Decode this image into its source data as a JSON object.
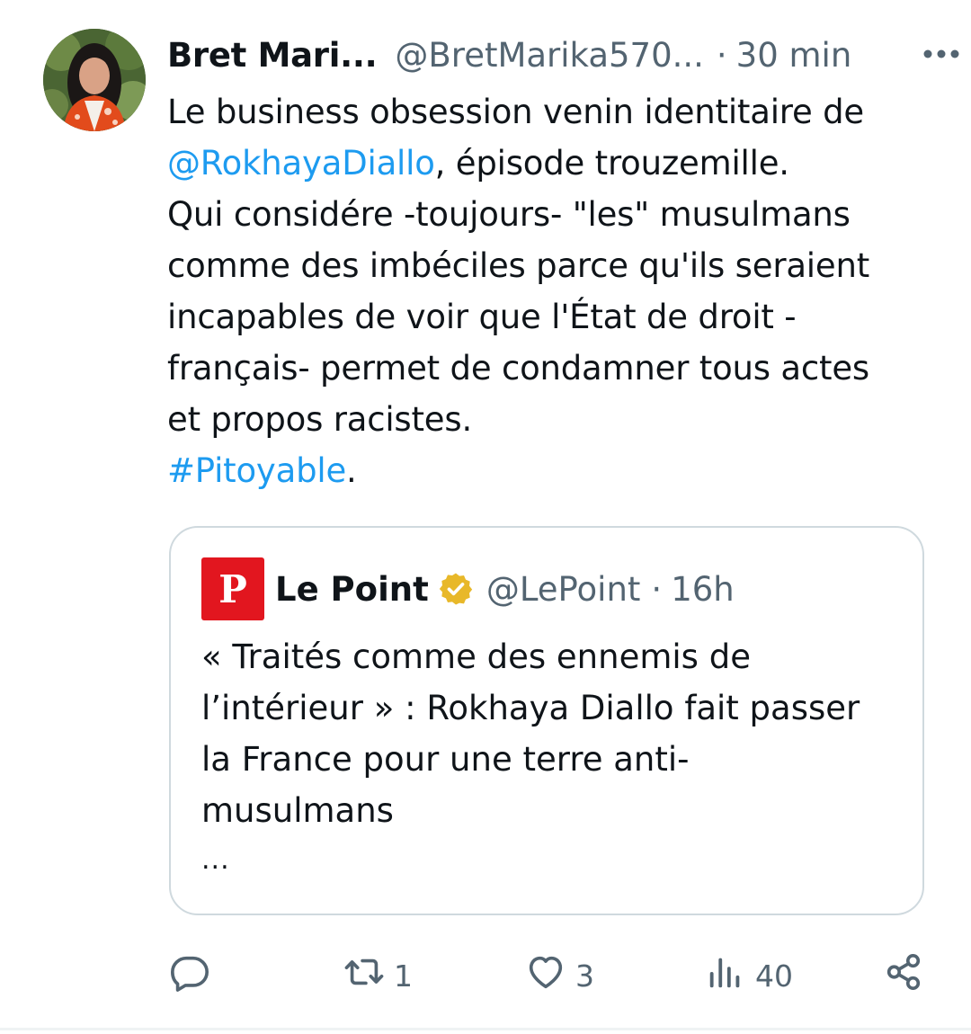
{
  "tweet": {
    "author_name": "Bret Mari...",
    "author_handle": "@BretMarika570...",
    "time_sep": "·",
    "timestamp": "30 min",
    "more_icon": "more-horizontal-icon",
    "text_lines": [
      "Le business obsession venin identitaire de",
      ", épisode trouzemille.",
      "Qui considére -toujours- \"les\" musulmans",
      "comme des imbéciles parce qu'ils seraient",
      "incapables de voir que l'État de droit -",
      "français- permet de condamner tous actes",
      "et propos racistes.",
      "."
    ],
    "mention": "@RokhayaDiallo",
    "hashtag": "#Pitoyable"
  },
  "quote": {
    "logo_letter": "P",
    "name": "Le Point",
    "badge_icon": "verified-gold-badge-icon",
    "handle": "@LePoint",
    "time_sep": "·",
    "timestamp": "16h",
    "text_lines": [
      "« Traités comme des ennemis de",
      "l’intérieur » : Rokhaya Diallo fait passer",
      "la France pour une terre anti-",
      "musulmans"
    ],
    "ellipsis": "..."
  },
  "actions": {
    "reply": {
      "icon": "reply-icon",
      "count": ""
    },
    "retweet": {
      "icon": "retweet-icon",
      "count": "1"
    },
    "like": {
      "icon": "heart-icon",
      "count": "3"
    },
    "views": {
      "icon": "views-icon",
      "count": "40"
    },
    "share": {
      "icon": "share-icon"
    }
  },
  "colors": {
    "link": "#1d9bf0",
    "secondary_text": "#536471",
    "primary_text": "#0f1419",
    "border": "#cfd9de",
    "le_point_red": "#e2161f",
    "verified_gold": "#e8b829"
  }
}
